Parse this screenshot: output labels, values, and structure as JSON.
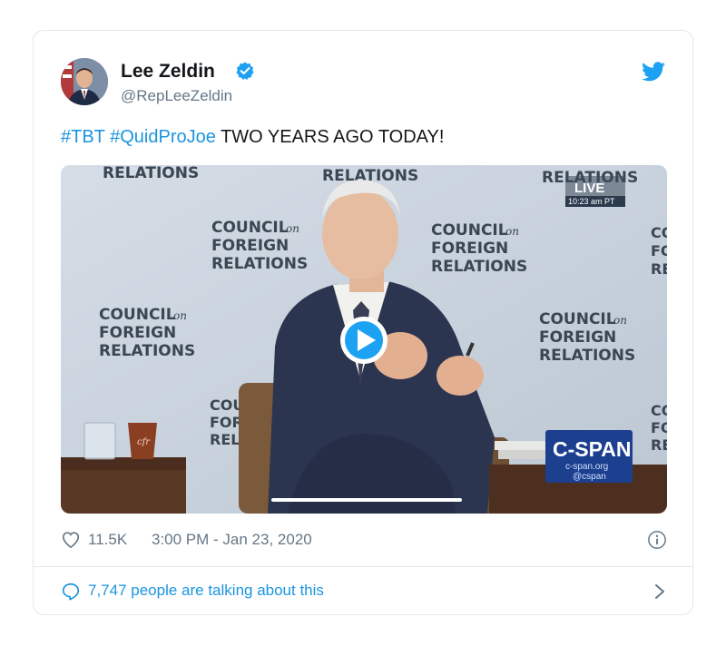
{
  "author": {
    "name": "Lee Zeldin",
    "handle": "@RepLeeZeldin"
  },
  "tweet": {
    "hashtag_1": "#TBT",
    "hashtag_2": "#QuidProJoe",
    "text": "TWO YEARS AGO TODAY!"
  },
  "video": {
    "backdrop_line_1": "COUNCIL",
    "backdrop_on": "on",
    "backdrop_line_2": "FOREIGN",
    "backdrop_line_3": "RELATIONS",
    "live_badge": "LIVE",
    "live_time": "10:23 am PT",
    "network_logo": "C-SPAN",
    "network_url": "c-span.org",
    "network_handle": "@cspan",
    "cup_logo": "cfr",
    "play_icon": "play-icon",
    "playback_progress": 0
  },
  "stats": {
    "likes": "11.5K",
    "timestamp": "3:00 PM - Jan 23, 2020"
  },
  "conversation": {
    "label": "7,747 people are talking about this"
  },
  "colors": {
    "link_blue": "#1b95e0",
    "secondary_text": "#657786",
    "border": "#e1e8ed",
    "cspan_blue": "#1d3f8f"
  },
  "icons": [
    "verified-badge-icon",
    "twitter-bird-icon",
    "heart-icon",
    "info-icon",
    "speech-bubble-icon",
    "chevron-right-icon",
    "play-icon"
  ]
}
